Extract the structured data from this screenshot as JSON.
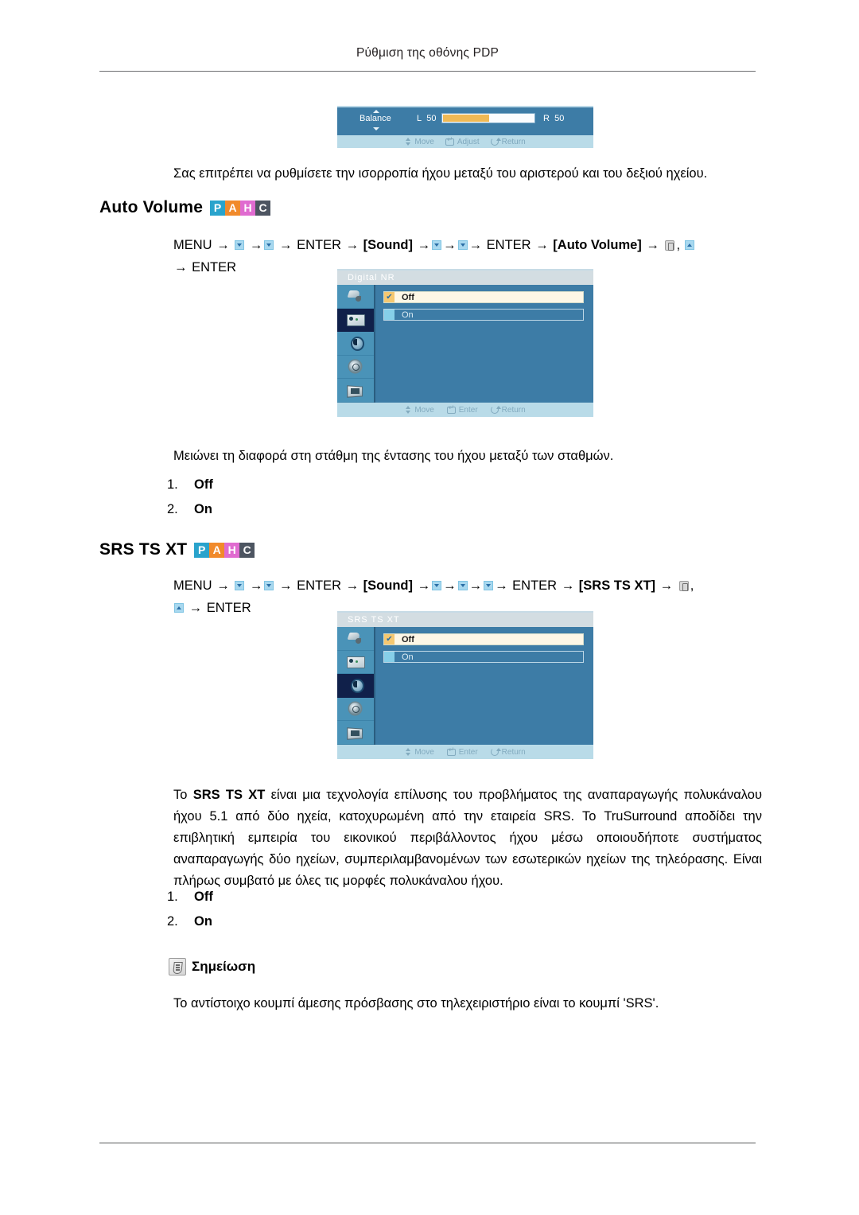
{
  "header": {
    "running_title": "Ρύθμιση της οθόνης PDP"
  },
  "balance_osd": {
    "label": "Balance",
    "left_label": "L",
    "left_value": "50",
    "right_label": "R",
    "right_value": "50",
    "hints": {
      "move": "Move",
      "adjust": "Adjust",
      "return": "Return"
    }
  },
  "balance_description": "Σας επιτρέπει να ρυθμίσετε την ισορροπία ήχου μεταξύ του αριστερού και του δεξιού ηχείου.",
  "auto_volume": {
    "heading": "Auto Volume",
    "badges": [
      {
        "letter": "P",
        "color": "#29a3cc"
      },
      {
        "letter": "A",
        "color": "#f18a2b"
      },
      {
        "letter": "H",
        "color": "#e06bd0"
      },
      {
        "letter": "C",
        "color": "#4d5561"
      }
    ],
    "path": {
      "menu": "MENU",
      "enter1": "ENTER",
      "sound": "[Sound]",
      "enter2": "ENTER",
      "target": "[Auto Volume]",
      "comma": ",",
      "enter3": "ENTER"
    },
    "osd": {
      "title": "Digital  NR",
      "options": [
        {
          "label": "Off",
          "selected": true
        },
        {
          "label": "On",
          "selected": false
        }
      ],
      "selected_side_index": 1,
      "hints": {
        "move": "Move",
        "enter": "Enter",
        "return": "Return"
      }
    },
    "description": "Μειώνει τη διαφορά στη στάθμη της έντασης του ήχου μεταξύ των σταθμών.",
    "list": [
      {
        "num": "1.",
        "value": "Off"
      },
      {
        "num": "2.",
        "value": "On"
      }
    ]
  },
  "srs": {
    "heading": "SRS TS XT",
    "badges": [
      {
        "letter": "P",
        "color": "#29a3cc"
      },
      {
        "letter": "A",
        "color": "#f18a2b"
      },
      {
        "letter": "H",
        "color": "#e06bd0"
      },
      {
        "letter": "C",
        "color": "#4d5561"
      }
    ],
    "path": {
      "menu": "MENU",
      "enter1": "ENTER",
      "sound": "[Sound]",
      "enter2": "ENTER",
      "target": "[SRS TS XT]",
      "comma": ",",
      "enter3": "ENTER"
    },
    "osd": {
      "title": "SRS  TS  XT",
      "options": [
        {
          "label": "Off",
          "selected": true
        },
        {
          "label": "On",
          "selected": false
        }
      ],
      "selected_side_index": 2,
      "hints": {
        "move": "Move",
        "enter": "Enter",
        "return": "Return"
      }
    },
    "description": "Το SRS TS XT είναι μια τεχνολογία επίλυσης του προβλήματος της αναπαραγωγής πολυκάναλου ήχου 5.1 από δύο ηχεία, κατοχυρωμένη από την εταιρεία SRS. Το TruSurround αποδίδει την επιβλητική εμπειρία του εικονικού περιβάλλοντος ήχου μέσω οποιουδήποτε συστήματος αναπαραγωγής δύο ηχείων, συμπεριλαμβανομένων των εσωτερικών ηχείων της τηλεόρασης. Είναι πλήρως συμβατό με όλες τις μορφές πολυκάναλου ήχου.",
    "description_bold_term": "SRS TS XT",
    "list": [
      {
        "num": "1.",
        "value": "Off"
      },
      {
        "num": "2.",
        "value": "On"
      }
    ]
  },
  "note": {
    "title": "Σημείωση",
    "text": "Το αντίστοιχο κουμπί άμεσης πρόσβασης στο τηλεχειριστήριο είναι το κουμπί 'SRS'."
  },
  "icons": {
    "note": "note-pencil-icon",
    "key_down": "key-down-icon",
    "key_up": "key-up-icon",
    "remote": "remote-button-icon",
    "side_brush": "picture-brush-icon",
    "side_screen": "screen-icon",
    "side_sound": "sound-icon",
    "side_setup": "setup-gear-icon",
    "side_multi": "multi-control-icon"
  }
}
